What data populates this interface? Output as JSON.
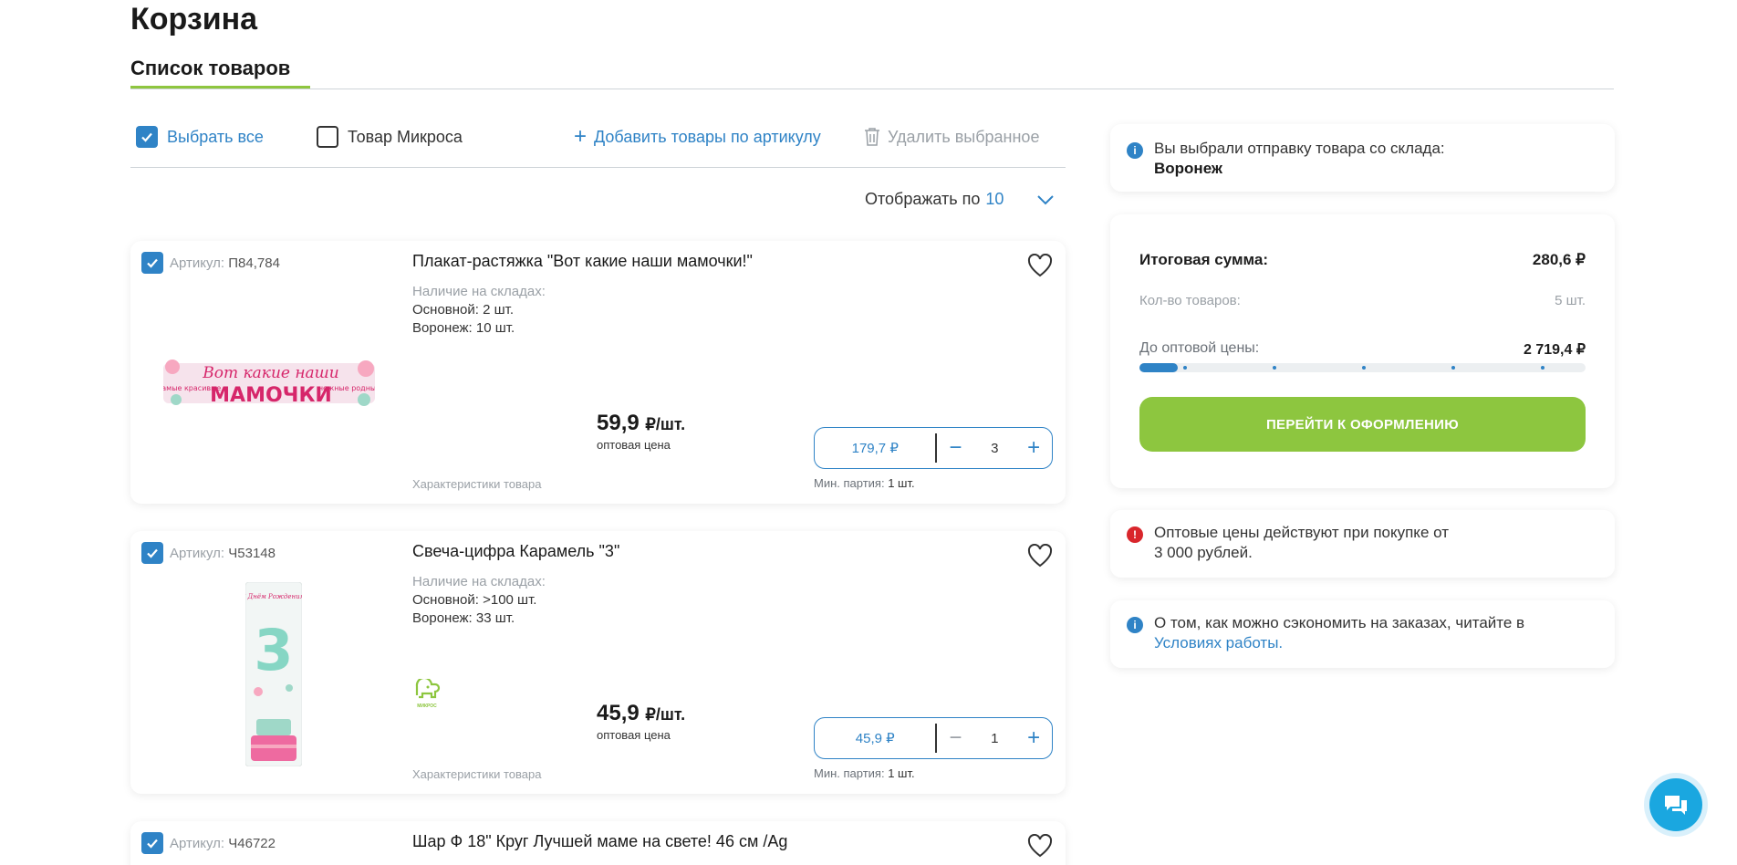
{
  "page": {
    "title": "Корзина",
    "tab": "Список товаров"
  },
  "toolbar": {
    "select_all": "Выбрать все",
    "mikros_filter": "Товар Микроса",
    "add_by_sku": "Добавить товары по артикулу",
    "delete_selected": "Удалить выбранное"
  },
  "per_page": {
    "label": "Отображать по",
    "value": "10"
  },
  "products": [
    {
      "sku_label": "Артикул:",
      "sku": "П84,784",
      "title": "Плакат-растяжка \"Вот какие наши мамочки!\"",
      "stock_label": "Наличие на складах:",
      "stock_main": "Основной: 2 шт.",
      "stock_voronezh": "Воронеж: 10 шт.",
      "price": "59,9",
      "price_unit": "₽/шт.",
      "price_note": "оптовая цена",
      "characteristics": "Характеристики товара",
      "total": "179,7 ₽",
      "qty": "3",
      "min_batch_label": "Мин. партия:",
      "min_batch": "1 шт.",
      "banner_top": "Вот какие наши",
      "banner_main": "МАМОЧКИ",
      "banner_left": "Самые красивые",
      "banner_right": "нежные родные"
    },
    {
      "sku_label": "Артикул:",
      "sku": "Ч53148",
      "title": "Свеча-цифра Карамель \"3\"",
      "stock_label": "Наличие на складах:",
      "stock_main": "Основной: >100 шт.",
      "stock_voronezh": "Воронеж: 33 шт.",
      "price": "45,9",
      "price_unit": "₽/шт.",
      "price_note": "оптовая цена",
      "characteristics": "Характеристики товара",
      "total": "45,9 ₽",
      "qty": "1",
      "min_batch_label": "Мин. партия:",
      "min_batch": "1 шт.",
      "brand_badge": "МИКРОС",
      "candle_digit": "3",
      "candle_text": "С Днём Рождения!"
    },
    {
      "sku_label": "Артикул:",
      "sku": "Ч46722",
      "title": "Шар Ф 18\" Круг Лучшей маме на свете! 46 см /Ag"
    }
  ],
  "sidebar": {
    "warehouse_text": "Вы выбрали отправку товара со склада:",
    "warehouse_name": "Воронеж",
    "total_label": "Итоговая сумма:",
    "total_value": "280,6 ₽",
    "count_label": "Кол-во товаров:",
    "count_value": "5 шт.",
    "wholesale_label": "До оптовой цены:",
    "wholesale_value": "2 719,4 ₽",
    "wholesale_progress": 0.085,
    "checkout": "ПЕРЕЙТИ К ОФОРМЛЕНИЮ",
    "wholesale_notice_1": "Оптовые цены действуют при покупке от",
    "wholesale_notice_2": "3 000 рублей.",
    "savings_text": "О том, как можно сэкономить на заказах, читайте в",
    "savings_link": "Условиях работы."
  },
  "colors": {
    "accent": "#2f83c6",
    "green": "#8dc63f",
    "alert": "#d9262c"
  }
}
